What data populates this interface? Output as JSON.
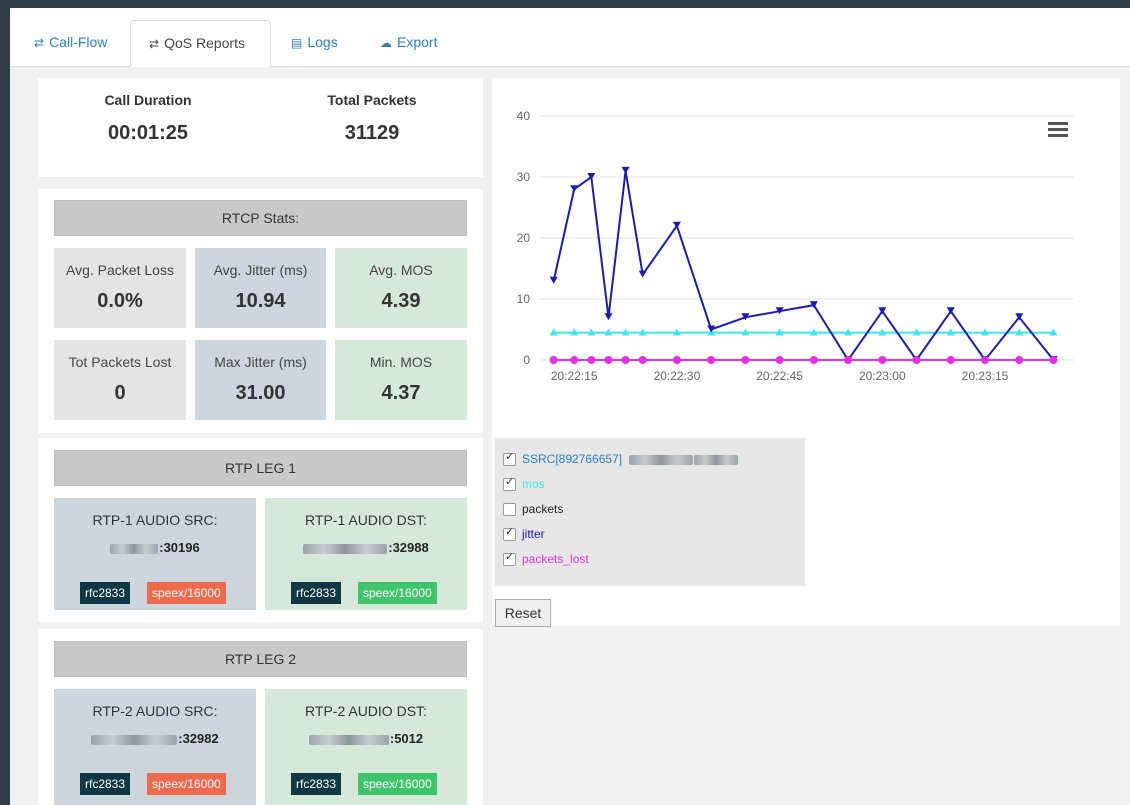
{
  "tabs": [
    {
      "label": "Call-Flow",
      "icon": "swap-icon"
    },
    {
      "label": "QoS Reports",
      "icon": "swap-icon"
    },
    {
      "label": "Logs",
      "icon": "document-icon"
    },
    {
      "label": "Export",
      "icon": "cloud-icon"
    }
  ],
  "summary": {
    "duration_label": "Call Duration",
    "duration_value": "00:01:25",
    "packets_label": "Total Packets",
    "packets_value": "31129"
  },
  "rtcp": {
    "title": "RTCP Stats:",
    "cells": [
      {
        "label": "Avg. Packet Loss",
        "value": "0.0%"
      },
      {
        "label": "Avg. Jitter (ms)",
        "value": "10.94"
      },
      {
        "label": "Avg. MOS",
        "value": "4.39"
      },
      {
        "label": "Tot Packets Lost",
        "value": "0"
      },
      {
        "label": "Max Jitter (ms)",
        "value": "31.00"
      },
      {
        "label": "Min. MOS",
        "value": "4.37"
      }
    ]
  },
  "legs": [
    {
      "title": "RTP LEG 1",
      "src": {
        "label": "RTP-1 AUDIO SRC:",
        "port": ":30196",
        "badge1": "rfc2833",
        "badge2": "speex/16000"
      },
      "dst": {
        "label": "RTP-1 AUDIO DST:",
        "port": ":32988",
        "badge1": "rfc2833",
        "badge2": "speex/16000"
      }
    },
    {
      "title": "RTP LEG 2",
      "src": {
        "label": "RTP-2 AUDIO SRC:",
        "port": ":32982",
        "badge1": "rfc2833",
        "badge2": "speex/16000"
      },
      "dst": {
        "label": "RTP-2 AUDIO DST:",
        "port": ":5012",
        "badge1": "rfc2833",
        "badge2": "speex/16000"
      }
    }
  ],
  "chart_data": {
    "type": "line",
    "x_ticks": [
      "20:22:15",
      "20:22:30",
      "20:22:45",
      "20:23:00",
      "20:23:15"
    ],
    "y_ticks": [
      "0",
      "10",
      "20",
      "30",
      "40"
    ],
    "ylim": [
      0,
      40
    ],
    "grid": true,
    "series": [
      {
        "name": "mos",
        "color": "#3ee6e6",
        "values": [
          {
            "t": "20:22:12",
            "v": 4.5
          },
          {
            "t": "20:22:15",
            "v": 4.5
          },
          {
            "t": "20:22:17.5",
            "v": 4.5
          },
          {
            "t": "20:22:20",
            "v": 4.5
          },
          {
            "t": "20:22:22.5",
            "v": 4.5
          },
          {
            "t": "20:22:25",
            "v": 4.5
          },
          {
            "t": "20:22:30",
            "v": 4.5
          },
          {
            "t": "20:22:35",
            "v": 4.5
          },
          {
            "t": "20:22:40",
            "v": 4.5
          },
          {
            "t": "20:22:45",
            "v": 4.5
          },
          {
            "t": "20:22:50",
            "v": 4.5
          },
          {
            "t": "20:22:55",
            "v": 4.5
          },
          {
            "t": "20:23:00",
            "v": 4.5
          },
          {
            "t": "20:23:05",
            "v": 4.5
          },
          {
            "t": "20:23:10",
            "v": 4.5
          },
          {
            "t": "20:23:15",
            "v": 4.5
          },
          {
            "t": "20:23:20",
            "v": 4.5
          },
          {
            "t": "20:23:25",
            "v": 4.5
          }
        ]
      },
      {
        "name": "jitter",
        "color": "#1a1ab8",
        "values": [
          {
            "t": "20:22:12",
            "v": 13
          },
          {
            "t": "20:22:15",
            "v": 28
          },
          {
            "t": "20:22:17.5",
            "v": 30
          },
          {
            "t": "20:22:20",
            "v": 7
          },
          {
            "t": "20:22:22.5",
            "v": 31
          },
          {
            "t": "20:22:25",
            "v": 14
          },
          {
            "t": "20:22:30",
            "v": 22
          },
          {
            "t": "20:22:35",
            "v": 5
          },
          {
            "t": "20:22:40",
            "v": 7
          },
          {
            "t": "20:22:45",
            "v": 8
          },
          {
            "t": "20:22:50",
            "v": 9
          },
          {
            "t": "20:22:55",
            "v": 0
          },
          {
            "t": "20:23:00",
            "v": 8
          },
          {
            "t": "20:23:05",
            "v": 0
          },
          {
            "t": "20:23:10",
            "v": 8
          },
          {
            "t": "20:23:15",
            "v": 0
          },
          {
            "t": "20:23:20",
            "v": 7
          },
          {
            "t": "20:23:25",
            "v": 0
          }
        ]
      },
      {
        "name": "packets_lost",
        "color": "#e62ee6",
        "values": [
          {
            "t": "20:22:12",
            "v": 0
          },
          {
            "t": "20:22:15",
            "v": 0
          },
          {
            "t": "20:22:17.5",
            "v": 0
          },
          {
            "t": "20:22:20",
            "v": 0
          },
          {
            "t": "20:22:22.5",
            "v": 0
          },
          {
            "t": "20:22:25",
            "v": 0
          },
          {
            "t": "20:22:30",
            "v": 0
          },
          {
            "t": "20:22:35",
            "v": 0
          },
          {
            "t": "20:22:40",
            "v": 0
          },
          {
            "t": "20:22:45",
            "v": 0
          },
          {
            "t": "20:22:50",
            "v": 0
          },
          {
            "t": "20:22:55",
            "v": 0
          },
          {
            "t": "20:23:00",
            "v": 0
          },
          {
            "t": "20:23:05",
            "v": 0
          },
          {
            "t": "20:23:10",
            "v": 0
          },
          {
            "t": "20:23:15",
            "v": 0
          },
          {
            "t": "20:23:20",
            "v": 0
          },
          {
            "t": "20:23:25",
            "v": 0
          }
        ]
      }
    ]
  },
  "legend": [
    {
      "label": "SSRC[892766657]",
      "checked": true,
      "color": "#2a7fbf"
    },
    {
      "label": "mos",
      "checked": true,
      "color": "#3ee6e6"
    },
    {
      "label": "packets",
      "checked": false,
      "color": "#222222"
    },
    {
      "label": "jitter",
      "checked": true,
      "color": "#1a1ab8"
    },
    {
      "label": "packets_lost",
      "checked": true,
      "color": "#e62ee6"
    }
  ],
  "reset_label": "Reset"
}
